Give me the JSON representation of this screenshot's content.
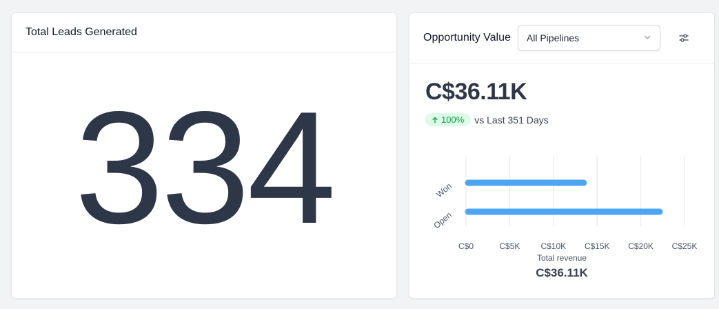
{
  "leads_card": {
    "title": "Total Leads Generated",
    "value": "334"
  },
  "opportunity_card": {
    "title": "Opportunity Value",
    "pipeline_select": "All Pipelines",
    "dropdown_icon": "chevron-down-icon",
    "filter_icon": "sliders-icon",
    "metric": "C$36.11K",
    "change_badge": "100%",
    "change_icon": "arrow-up-icon",
    "change_text": "vs Last 351 Days",
    "footer_label": "Total revenue",
    "footer_value": "C$36.11K"
  },
  "colors": {
    "bar": "#4da6f5",
    "badge_bg": "#dcfce7",
    "badge_text": "#16a34a",
    "number": "#2d3748"
  },
  "chart_data": {
    "type": "bar",
    "orientation": "horizontal",
    "categories": [
      "Won",
      "Open"
    ],
    "values": [
      13700,
      22400
    ],
    "x_ticks": [
      "C$0",
      "C$5K",
      "C$10K",
      "C$15K",
      "C$20K",
      "C$25K"
    ],
    "xlim": [
      0,
      25000
    ],
    "grid": true
  }
}
